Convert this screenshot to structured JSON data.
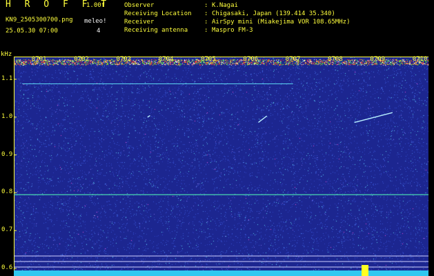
{
  "header": {
    "app_title": "H R O F F T",
    "version": "1.00f",
    "filename": "KN9_2505300700.png",
    "mode_label": "meleo!",
    "mode_value": "4",
    "datetime": "25.05.30 07:00",
    "meta": [
      {
        "label": "Observer",
        "value": "K.Nagai"
      },
      {
        "label": "Receiving Location",
        "value": "Chigasaki, Japan (139.414 35.340)"
      },
      {
        "label": "Receiver",
        "value": "AirSpy mini (Miakejima VOR 108.65MHz)"
      },
      {
        "label": "Receiving antenna",
        "value": "Maspro FM-3"
      }
    ],
    "separator": ":"
  },
  "chart_data": {
    "type": "heatmap",
    "ylabel": "kHz",
    "y_ticks": [
      "1.1",
      "1.0",
      "0.9",
      "0.8",
      "0.7",
      "0.6"
    ],
    "y_tick_values": [
      1.1,
      1.0,
      0.9,
      0.8,
      0.7,
      0.6
    ],
    "ylim": [
      0.58,
      1.16
    ],
    "x_ticks": [
      "0701",
      "0702",
      "0703",
      "0704",
      "0705",
      "0706",
      "0707",
      "0708",
      "0709",
      "0710"
    ],
    "x_tick_values": [
      1,
      2,
      3,
      4,
      5,
      6,
      7,
      8,
      9,
      10
    ],
    "xlim": [
      0.4,
      10.2
    ],
    "background_color": "#1c2690",
    "noise_color": "#5bd4f0",
    "axis_color": "#ffff3c",
    "hot_band_khz": 1.145,
    "carrier_line_khz": 0.795,
    "faint_line_khz": 1.088,
    "meteor_streaks": [
      {
        "x1": 8.45,
        "y1": 0.986,
        "x2": 9.35,
        "y2": 1.012
      },
      {
        "x1": 6.18,
        "y1": 0.986,
        "x2": 6.38,
        "y2": 1.003
      },
      {
        "x1": 3.56,
        "y1": 1.0,
        "x2": 3.62,
        "y2": 1.004
      }
    ]
  }
}
